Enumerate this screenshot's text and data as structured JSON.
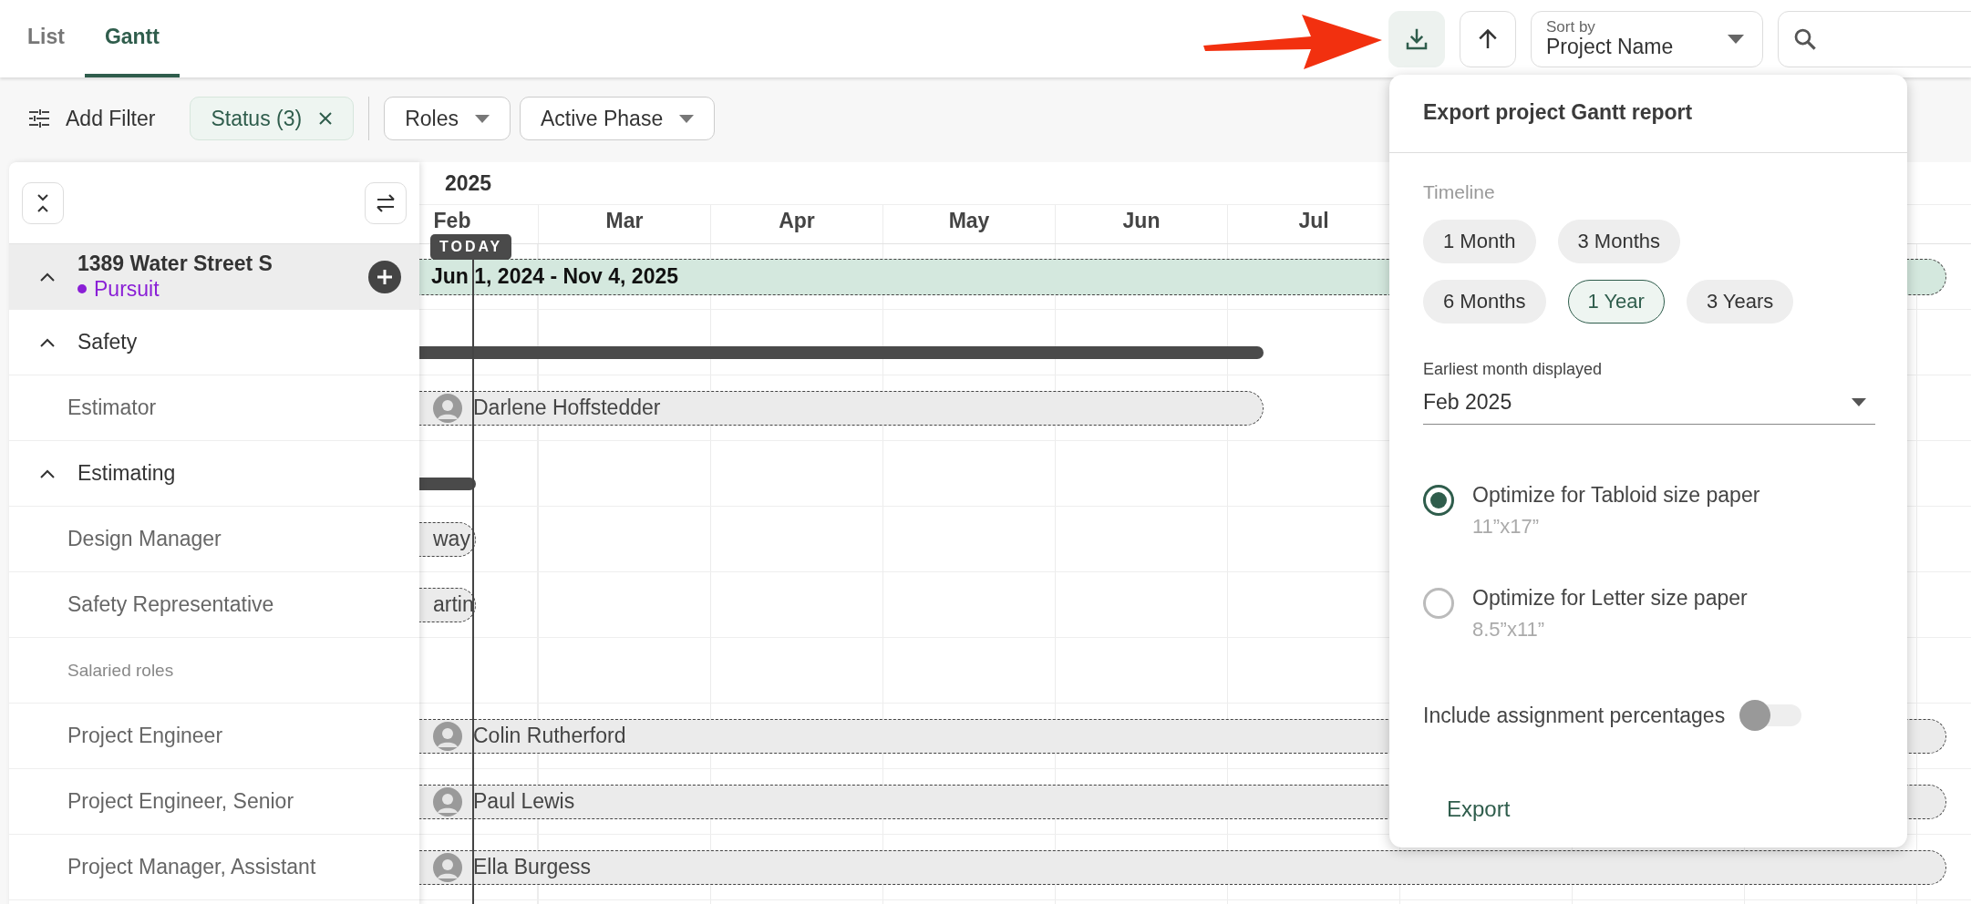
{
  "tabs": [
    {
      "label": "List",
      "selected": false
    },
    {
      "label": "Gantt",
      "selected": true
    }
  ],
  "toolbar": {
    "sort": {
      "label": "Sort by",
      "value": "Project Name"
    }
  },
  "filters": {
    "add_filter": "Add Filter",
    "chips": [
      {
        "label": "Status (3)",
        "applied": true
      },
      {
        "label": "Roles",
        "applied": false
      },
      {
        "label": "Active Phase",
        "applied": false
      }
    ]
  },
  "gantt": {
    "year": "2025",
    "months": [
      "Feb",
      "Mar",
      "Apr",
      "May",
      "Jun",
      "Jul"
    ],
    "today": "TODAY",
    "rows": [
      {
        "kind": "project",
        "label": "1389 Water Street S",
        "expanded": true,
        "status": {
          "label": "Pursuit",
          "color": "#8a1fd6"
        },
        "bar": "Jun 1, 2024 - Nov 4, 2025"
      },
      {
        "kind": "phase",
        "label": "Safety",
        "expanded": true
      },
      {
        "kind": "role",
        "label": "Estimator",
        "assignee": "Darlene Hoffstedder",
        "avatar": true
      },
      {
        "kind": "phase",
        "label": "Estimating",
        "expanded": true
      },
      {
        "kind": "role",
        "label": "Design Manager",
        "assignee": "way",
        "avatar": false
      },
      {
        "kind": "role",
        "label": "Safety Representative",
        "assignee": "artin",
        "avatar": false
      },
      {
        "kind": "group",
        "label": "Salaried roles"
      },
      {
        "kind": "role",
        "label": "Project Engineer",
        "assignee": "Colin Rutherford",
        "avatar": true
      },
      {
        "kind": "role",
        "label": "Project Engineer, Senior",
        "assignee": "Paul Lewis",
        "avatar": true
      },
      {
        "kind": "role",
        "label": "Project Manager, Assistant",
        "assignee": "Ella Burgess",
        "avatar": true
      }
    ]
  },
  "export_dialog": {
    "title": "Export project Gantt report",
    "timeline_label": "Timeline",
    "timeline_options": [
      {
        "label": "1 Month",
        "selected": false
      },
      {
        "label": "3 Months",
        "selected": false
      },
      {
        "label": "6 Months",
        "selected": false
      },
      {
        "label": "1 Year",
        "selected": true
      },
      {
        "label": "3 Years",
        "selected": false
      }
    ],
    "earliest_month": {
      "label": "Earliest month displayed",
      "value": "Feb 2025"
    },
    "paper_options": [
      {
        "label": "Optimize for Tabloid size paper",
        "size": "11”x17”",
        "selected": true
      },
      {
        "label": "Optimize for Letter size paper",
        "size": "8.5”x11”",
        "selected": false
      }
    ],
    "include_percentages": {
      "label": "Include assignment percentages",
      "on": false
    },
    "export_button": "Export"
  }
}
